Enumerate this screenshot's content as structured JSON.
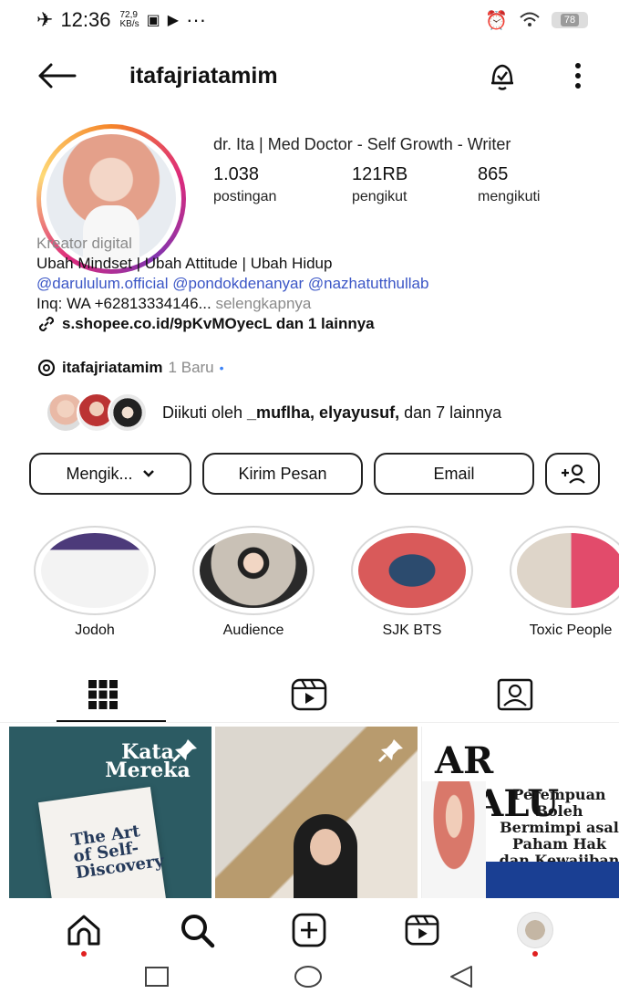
{
  "status_bar": {
    "time": "12:36",
    "speed_value": "72,9",
    "speed_unit": "KB/s",
    "dots": "···",
    "battery": "78"
  },
  "header": {
    "username": "itafajriatamim"
  },
  "profile": {
    "display_name": "dr. Ita | Med Doctor - Self Growth - Writer",
    "stats": [
      {
        "num": "1.038",
        "label": "postingan"
      },
      {
        "num": "121RB",
        "label": "pengikut"
      },
      {
        "num": "865",
        "label": "mengikuti"
      }
    ]
  },
  "bio": {
    "category": "Kreator digital",
    "line1": "Ubah Mindset | Ubah Attitude | Ubah Hidup",
    "mentions": "@darululum.official @pondokdenanyar @nazhatutthullab",
    "inquiry": "Inq: WA +62813334146...",
    "more": " selengkapnya",
    "link": "s.shopee.co.id/9pKvMOyecL dan 1 lainnya"
  },
  "threads": {
    "handle": "itafajriatamim",
    "badge": "1 Baru"
  },
  "followed_by": {
    "prefix": "Diikuti oleh ",
    "names": "_muflha, elyayusuf,",
    "suffix": " dan 7 lainnya"
  },
  "actions": {
    "following": "Mengik...",
    "message": "Kirim Pesan",
    "email": "Email"
  },
  "highlights": [
    {
      "label": "Jodoh"
    },
    {
      "label": "Audience"
    },
    {
      "label": "SJK BTS"
    },
    {
      "label": "Toxic People"
    }
  ],
  "posts": {
    "p1_title": "Kata Mereka",
    "p1_book": "The Art of Self-Discovery",
    "p3_head": "AR MALU",
    "p3_sub": "Perempuan Boleh Bermimpi asal Paham Hak dan Kewajiban"
  },
  "colors": {
    "mention_blue": "#3b56c6",
    "notif_red": "#e02020",
    "threads_dot": "#3b82f6"
  }
}
